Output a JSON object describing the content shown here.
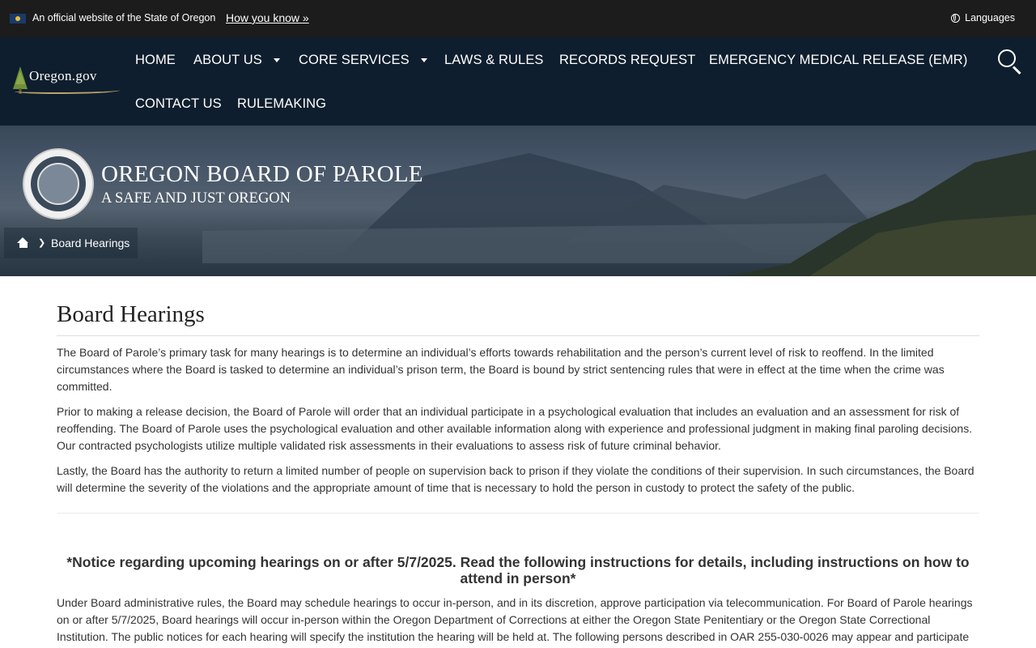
{
  "statebar": {
    "official_text": "An official website of the State of Oregon",
    "how_you_know": "How you know »",
    "languages": "Languages"
  },
  "logo": {
    "text": "Oregon.gov"
  },
  "nav": {
    "items": [
      {
        "label": "HOME",
        "dropdown": false
      },
      {
        "label": "ABOUT US",
        "dropdown": true
      },
      {
        "label": "CORE SERVICES",
        "dropdown": true
      },
      {
        "label": "LAWS & RULES",
        "dropdown": false
      },
      {
        "label": "RECORDS REQUEST",
        "dropdown": false
      },
      {
        "label": "EMERGENCY MEDICAL RELEASE (EMR)",
        "dropdown": false
      },
      {
        "label": "CONTACT US",
        "dropdown": false
      },
      {
        "label": "RULEMAKING",
        "dropdown": false
      }
    ]
  },
  "hero": {
    "title": "OREGON BOARD OF PAROLE",
    "tagline": "A SAFE AND JUST OREGON",
    "breadcrumb_current": "Board Hearings"
  },
  "content": {
    "title": "Board Hearings",
    "paragraphs": [
      "The Board of Parole’s primary task for many hearings is to determine an individual’s efforts towards rehabilitation and the person’s current level of risk to reoffend. In the limited circumstances where the Board is tasked to determine an individual’s prison term, the Board is bound by strict sentencing rules that were in effect at the time when the crime was committed.",
      "Prior to making a release decision, the Board of Parole will order that an individual participate in a psychological evaluation that includes an evaluation and an assessment for risk of reoffending. The Board of Parole uses the psychological evaluation and other available information along with experience and professional judgment in making final paroling decisions. Our contracted psychologists utilize multiple validated risk assessments in their evaluations to assess risk of future criminal behavior.",
      "Lastly, the Board has the authority to return a limited number of people on supervision back to prison if they violate the conditions of their supervision. In such circumstances, the Board will determine the severity of the violations and the appropriate amount of time that is necessary to hold the person in custody to protect the safety of the public."
    ],
    "notice": "*Notice regarding upcoming hearings on or after 5/7/2025. Read the following instructions for details, including instructions on how to attend in person*",
    "notice_body": "Under Board administrative rules, the Board may schedule hearings to occur in-person, and in its discretion, approve participation via telecommunication. For Board of Parole hearings on or after 5/7/2025, Board hearings will occur in-person within the Oregon Department of Corrections at either the Oregon State Penitentiary or the Oregon State Correctional Institution. The public notices for each hearing will specify the institution the hearing will be held at. The following persons described in OAR 255-030-0026 may appear and participate"
  }
}
